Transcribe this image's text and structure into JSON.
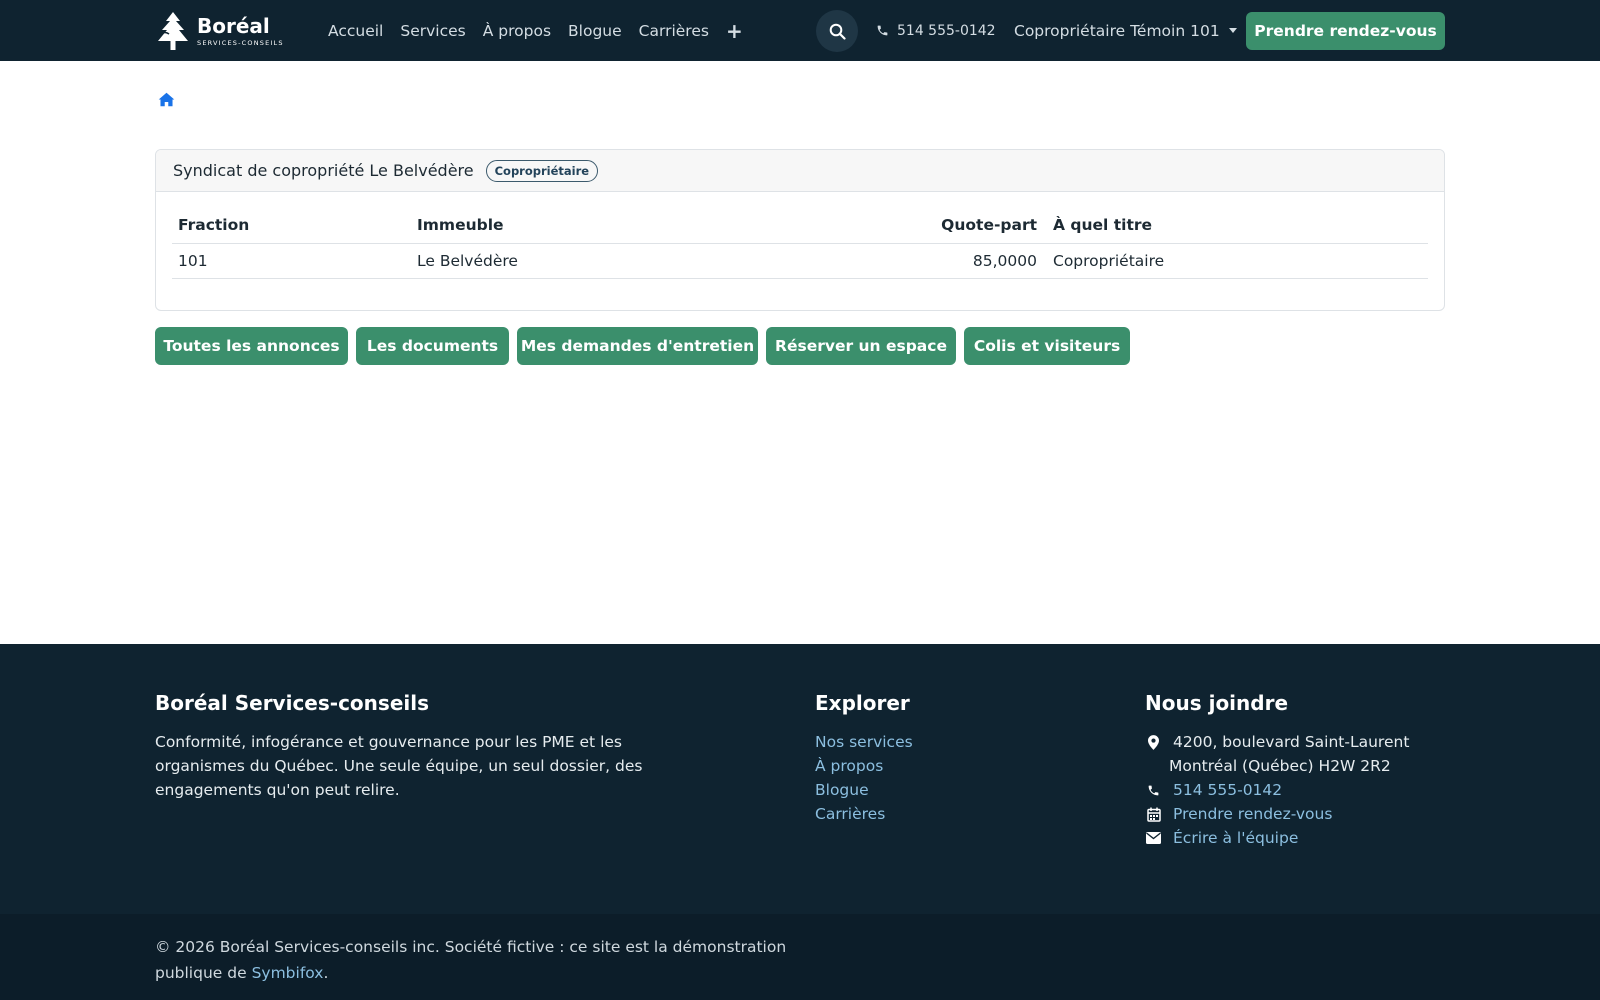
{
  "brand": {
    "name": "Boréal",
    "tagline": "SERVICES-CONSEILS",
    "logo_icon": "pine-tree-icon"
  },
  "nav": {
    "links": [
      "Accueil",
      "Services",
      "À propos",
      "Blogue",
      "Carrières"
    ],
    "more_icon": "plus-icon",
    "search_icon": "search-icon",
    "phone": "514 555-0142",
    "user": "Copropriétaire Témoin 101",
    "cta": "Prendre rendez-vous"
  },
  "breadcrumb": {
    "home_icon": "home-icon"
  },
  "card": {
    "title": "Syndicat de copropriété Le Belvédère",
    "badge": "Copropriétaire",
    "columns": [
      "Fraction",
      "Immeuble",
      "Quote-part",
      "À quel titre"
    ],
    "rows": [
      [
        "101",
        "Le Belvédère",
        "85,0000",
        "Copropriétaire"
      ]
    ]
  },
  "actions": [
    "Toutes les annonces",
    "Les documents",
    "Mes demandes d'entretien",
    "Réserver un espace",
    "Colis et visiteurs"
  ],
  "footer": {
    "about": {
      "heading": "Boréal Services-conseils",
      "text": "Conformité, infogérance et gouvernance pour les PME et les organismes du Québec. Une seule équipe, un seul dossier, des engagements qu'on peut relire."
    },
    "explore": {
      "heading": "Explorer",
      "links": [
        "Nos services",
        "À propos",
        "Blogue",
        "Carrières"
      ]
    },
    "contact": {
      "heading": "Nous joindre",
      "address_line1": "4200, boulevard Saint-Laurent",
      "address_line2": "Montréal (Québec) H2W 2R2",
      "phone": "514 555-0142",
      "booking": "Prendre rendez-vous",
      "email": "Écrire à l'équipe"
    },
    "copyright_prefix": "© 2026 Boréal Services-conseils inc. Société fictive : ce site est la démonstration publique de",
    "copyright_link": "Symbifox",
    "copyright_suffix": "."
  },
  "colors": {
    "navbar": "#0f2330",
    "accent": "#3b8f6c",
    "link": "#8cbfe0",
    "home_icon": "#1a73e8"
  }
}
